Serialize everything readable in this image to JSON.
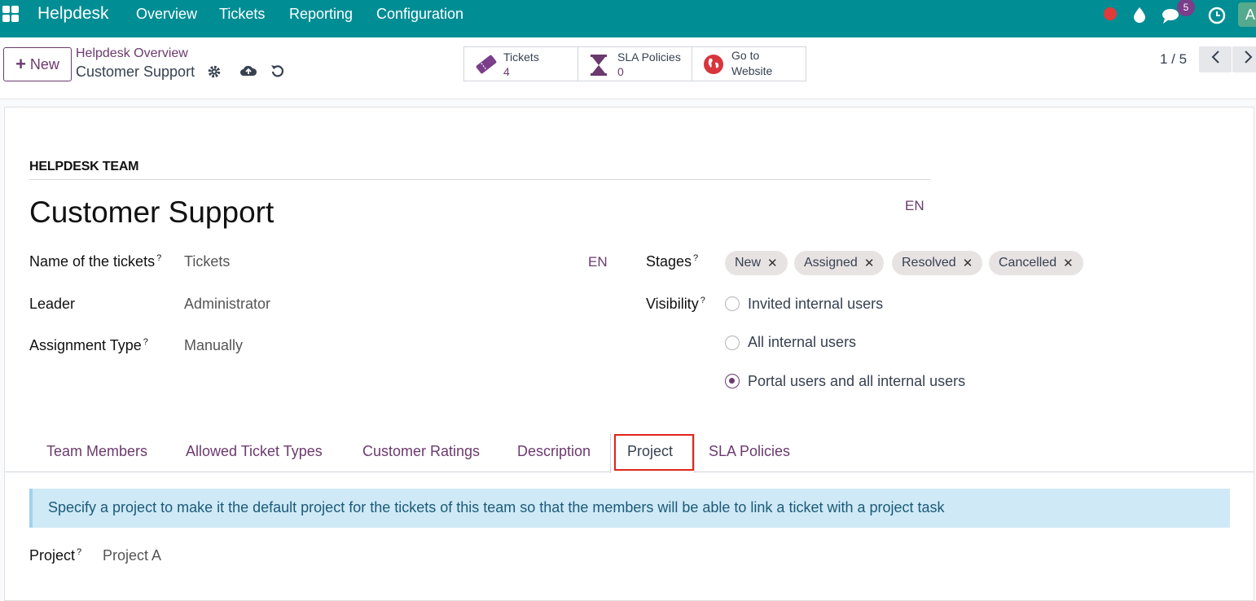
{
  "topbar": {
    "brand": "Helpdesk",
    "menu": [
      "Overview",
      "Tickets",
      "Reporting",
      "Configuration"
    ],
    "badge_count": "5",
    "avatar_letter": "A"
  },
  "control": {
    "new_label": "New",
    "breadcrumb_parent": "Helpdesk Overview",
    "breadcrumb_current": "Customer Support",
    "smart_buttons": [
      {
        "label": "Tickets",
        "value": "4"
      },
      {
        "label": "SLA Policies",
        "value": "0"
      },
      {
        "label": "Go to",
        "value": "Website"
      }
    ],
    "pager": "1 / 5"
  },
  "form": {
    "section_label": "HELPDESK TEAM",
    "title": "Customer Support",
    "title_lang": "EN",
    "name_of_tickets_label": "Name of the tickets",
    "name_of_tickets_value": "Tickets",
    "name_lang": "EN",
    "leader_label": "Leader",
    "leader_value": "Administrator",
    "assignment_label": "Assignment Type",
    "assignment_value": "Manually",
    "stages_label": "Stages",
    "stages": [
      "New",
      "Assigned",
      "Resolved",
      "Cancelled"
    ],
    "visibility_label": "Visibility",
    "visibility_options": [
      "Invited internal users",
      "All internal users",
      "Portal users and all internal users"
    ],
    "visibility_selected": "Portal users and all internal users",
    "help_mark": "?"
  },
  "tabs": [
    "Team Members",
    "Allowed Ticket Types",
    "Customer Ratings",
    "Description",
    "Project",
    "SLA Policies"
  ],
  "active_tab": "Project",
  "project_tab": {
    "alert": "Specify a project to make it the default project for the tickets of this team so that the members will be able to link a ticket with a project task",
    "project_label": "Project",
    "project_value": "Project A"
  },
  "colors": {
    "topbar": "#018d94",
    "accent": "#6b3a6e",
    "highlight_box": "#e0241a",
    "alert_bg": "#cfe9f7"
  }
}
